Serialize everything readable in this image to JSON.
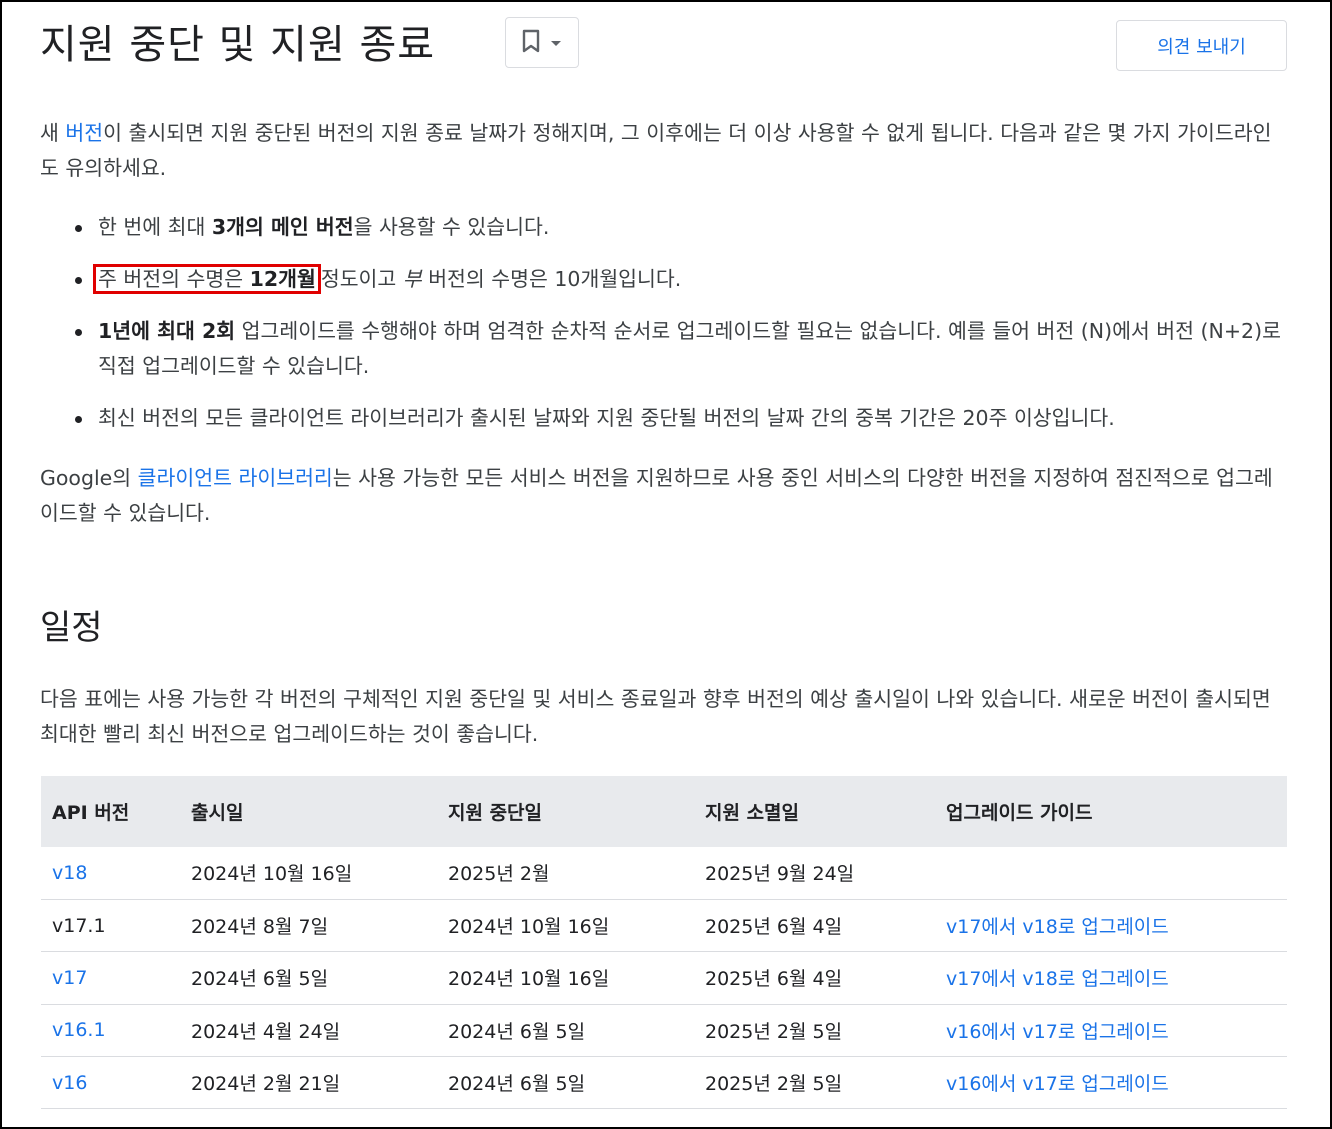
{
  "header": {
    "title": "지원 중단 및 지원 종료",
    "bookmark_icon": "bookmark-icon",
    "dropdown_icon": "caret-down-icon",
    "feedback_label": "의견 보내기"
  },
  "intro": {
    "before_link": "새 ",
    "link": "버전",
    "after_link": "이 출시되면 지원 중단된 버전의 지원 종료 날짜가 정해지며, 그 이후에는 더 이상 사용할 수 없게 됩니다. 다음과 같은 몇 가지 가이드라인도 유의하세요."
  },
  "bullets": {
    "b1_pre": "한 번에 최대 ",
    "b1_bold": "3개의 메인 버전",
    "b1_post": "을 사용할 수 있습니다.",
    "b2_hl_pre": "주 버전의 수명은 ",
    "b2_hl_bold": "12개월",
    "b2_mid": "정도이고 ",
    "b2_ital": "부",
    "b2_post": " 버전의 수명은 10개월입니다.",
    "b3_bold": "1년에 최대 2회",
    "b3_post": " 업그레이드를 수행해야 하며 엄격한 순차적 순서로 업그레이드할 필요는 없습니다. 예를 들어 버전 (N)에서 버전 (N+2)로 직접 업그레이드할 수 있습니다.",
    "b4": "최신 버전의 모든 클라이언트 라이브러리가 출시된 날짜와 지원 중단될 버전의 날짜 간의 중복 기간은 20주 이상입니다."
  },
  "libraries": {
    "before_link": "Google의 ",
    "link": "클라이언트 라이브러리",
    "after_link": "는 사용 가능한 모든 서비스 버전을 지원하므로 사용 중인 서비스의 다양한 버전을 지정하여 점진적으로 업그레이드할 수 있습니다."
  },
  "schedule": {
    "heading": "일정",
    "description": "다음 표에는 사용 가능한 각 버전의 구체적인 지원 중단일 및 서비스 종료일과 향후 버전의 예상 출시일이 나와 있습니다. 새로운 버전이 출시되면 최대한 빨리 최신 버전으로 업그레이드하는 것이 좋습니다."
  },
  "table": {
    "headers": [
      "API 버전",
      "출시일",
      "지원 중단일",
      "지원 소멸일",
      "업그레이드 가이드"
    ],
    "rows": [
      {
        "version": "v18",
        "version_link": true,
        "release": "2024년 10월 16일",
        "deprecation": "2025년 2월",
        "sunset": "2025년 9월 24일",
        "guide": ""
      },
      {
        "version": "v17.1",
        "version_link": false,
        "release": "2024년 8월 7일",
        "deprecation": "2024년 10월 16일",
        "sunset": "2025년 6월 4일",
        "guide": "v17에서 v18로 업그레이드"
      },
      {
        "version": "v17",
        "version_link": true,
        "release": "2024년 6월 5일",
        "deprecation": "2024년 10월 16일",
        "sunset": "2025년 6월 4일",
        "guide": "v17에서 v18로 업그레이드"
      },
      {
        "version": "v16.1",
        "version_link": true,
        "release": "2024년 4월 24일",
        "deprecation": "2024년 6월 5일",
        "sunset": "2025년 2월 5일",
        "guide": "v16에서 v17로 업그레이드"
      },
      {
        "version": "v16",
        "version_link": true,
        "release": "2024년 2월 21일",
        "deprecation": "2024년 6월 5일",
        "sunset": "2025년 2월 5일",
        "guide": "v16에서 v17로 업그레이드"
      }
    ]
  },
  "colors": {
    "link": "#1a73e8",
    "highlight_box": "#e00000",
    "table_header_bg": "#e8eaed"
  }
}
